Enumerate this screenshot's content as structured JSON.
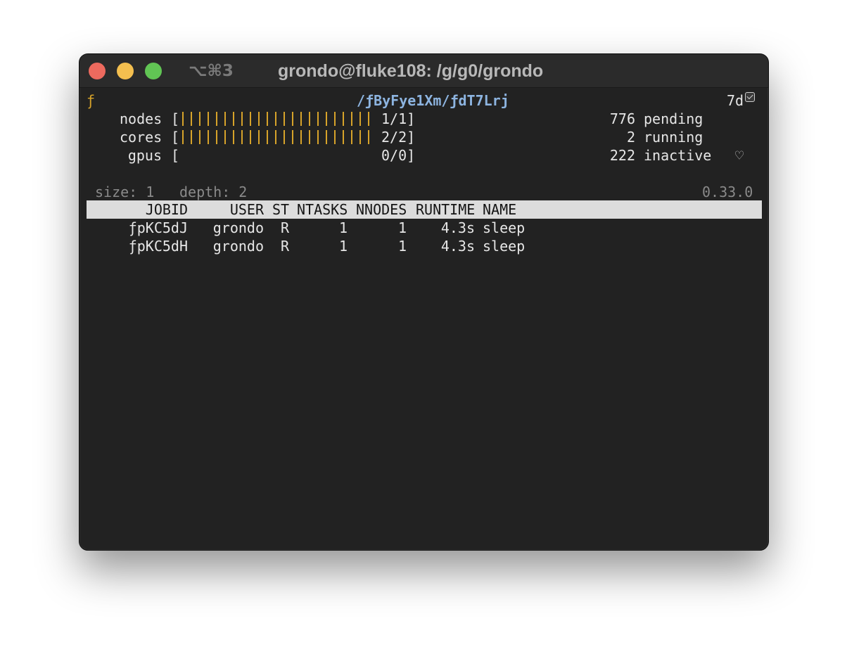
{
  "window": {
    "tab_shortcut": "⌥⌘3",
    "title": "grondo@fluke108: /g/g0/grondo"
  },
  "top": {
    "logo_glyph": "ƒ",
    "jobid_path": "/ƒByFye1Xm/ƒdT7Lrj",
    "time_remaining": "7d"
  },
  "resources": [
    {
      "label": "nodes",
      "count": "1/1",
      "fill_fraction": 1.0
    },
    {
      "label": "cores",
      "count": "2/2",
      "fill_fraction": 1.0
    },
    {
      "label": "gpus",
      "count": "0/0",
      "fill_fraction": 0.0
    }
  ],
  "job_counts": [
    {
      "value": "776",
      "label": "pending"
    },
    {
      "value": "2",
      "label": "running"
    },
    {
      "value": "222",
      "label": "inactive"
    }
  ],
  "heart_glyph": "♡",
  "info": {
    "size": "size: 1",
    "depth": "depth: 2",
    "version": "0.33.0"
  },
  "table": {
    "columns": [
      "JOBID",
      "USER",
      "ST",
      "NTASKS",
      "NNODES",
      "RUNTIME",
      "NAME"
    ],
    "rows": [
      {
        "jobid": "ƒpKC5dJ",
        "user": "grondo",
        "st": "R",
        "ntasks": "1",
        "nnodes": "1",
        "runtime": "4.3s",
        "name": "sleep"
      },
      {
        "jobid": "ƒpKC5dH",
        "user": "grondo",
        "st": "R",
        "ntasks": "1",
        "nnodes": "1",
        "runtime": "4.3s",
        "name": "sleep"
      }
    ]
  },
  "colors": {
    "accent_yellow": "#d7a32a",
    "jobid_blue": "#8db4e0",
    "terminal_bg": "#222222",
    "header_bg": "#dcdcdc"
  }
}
